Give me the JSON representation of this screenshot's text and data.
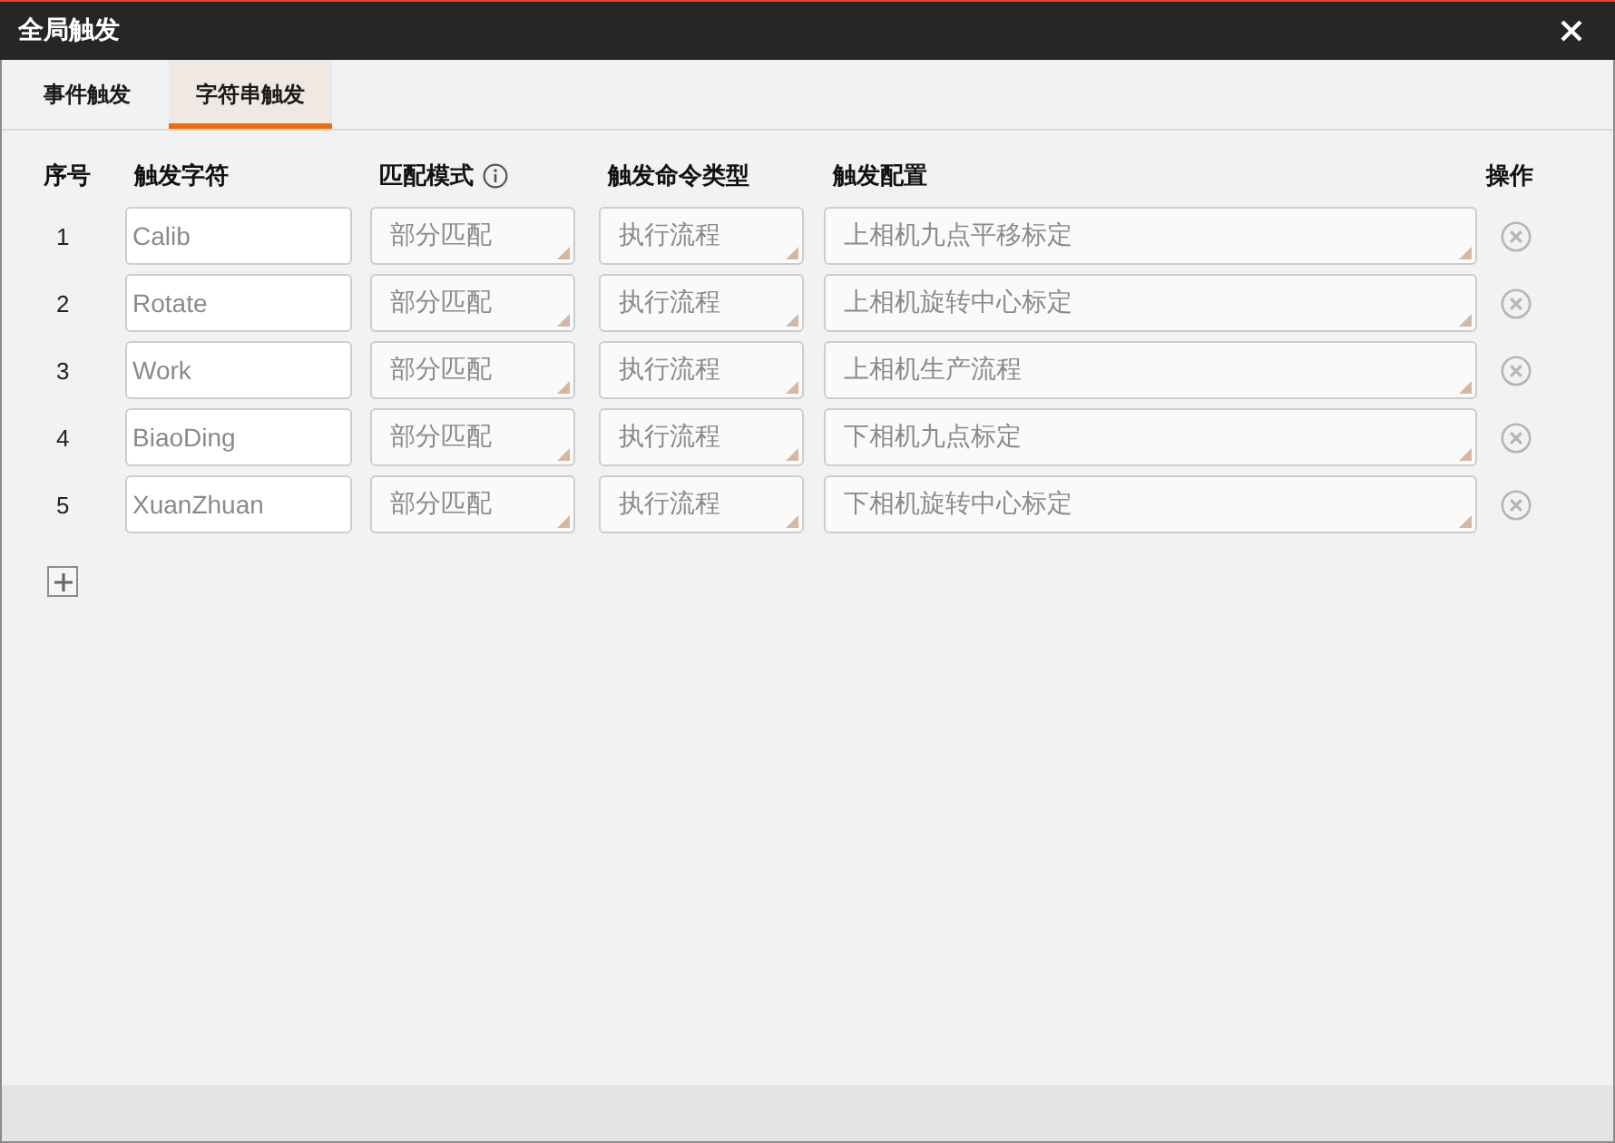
{
  "window": {
    "title": "全局触发"
  },
  "tabs": [
    {
      "label": "事件触发",
      "selected": false
    },
    {
      "label": "字符串触发",
      "selected": true
    }
  ],
  "table": {
    "columns": [
      {
        "label": "序号",
        "info": false
      },
      {
        "label": "触发字符",
        "info": false
      },
      {
        "label": "匹配模式",
        "info": true
      },
      {
        "label": "触发命令类型",
        "info": false
      },
      {
        "label": "触发配置",
        "info": false
      },
      {
        "label": "操作",
        "info": false
      }
    ],
    "rows": [
      {
        "index": "1",
        "trigger": "Calib",
        "match_mode": "部分匹配",
        "command_type": "执行流程",
        "config": "上相机九点平移标定"
      },
      {
        "index": "2",
        "trigger": "Rotate",
        "match_mode": "部分匹配",
        "command_type": "执行流程",
        "config": "上相机旋转中心标定"
      },
      {
        "index": "3",
        "trigger": "Work",
        "match_mode": "部分匹配",
        "command_type": "执行流程",
        "config": "上相机生产流程"
      },
      {
        "index": "4",
        "trigger": "BiaoDing",
        "match_mode": "部分匹配",
        "command_type": "执行流程",
        "config": "下相机九点标定"
      },
      {
        "index": "5",
        "trigger": "XuanZhuan",
        "match_mode": "部分匹配",
        "command_type": "执行流程",
        "config": "下相机旋转中心标定"
      }
    ]
  }
}
